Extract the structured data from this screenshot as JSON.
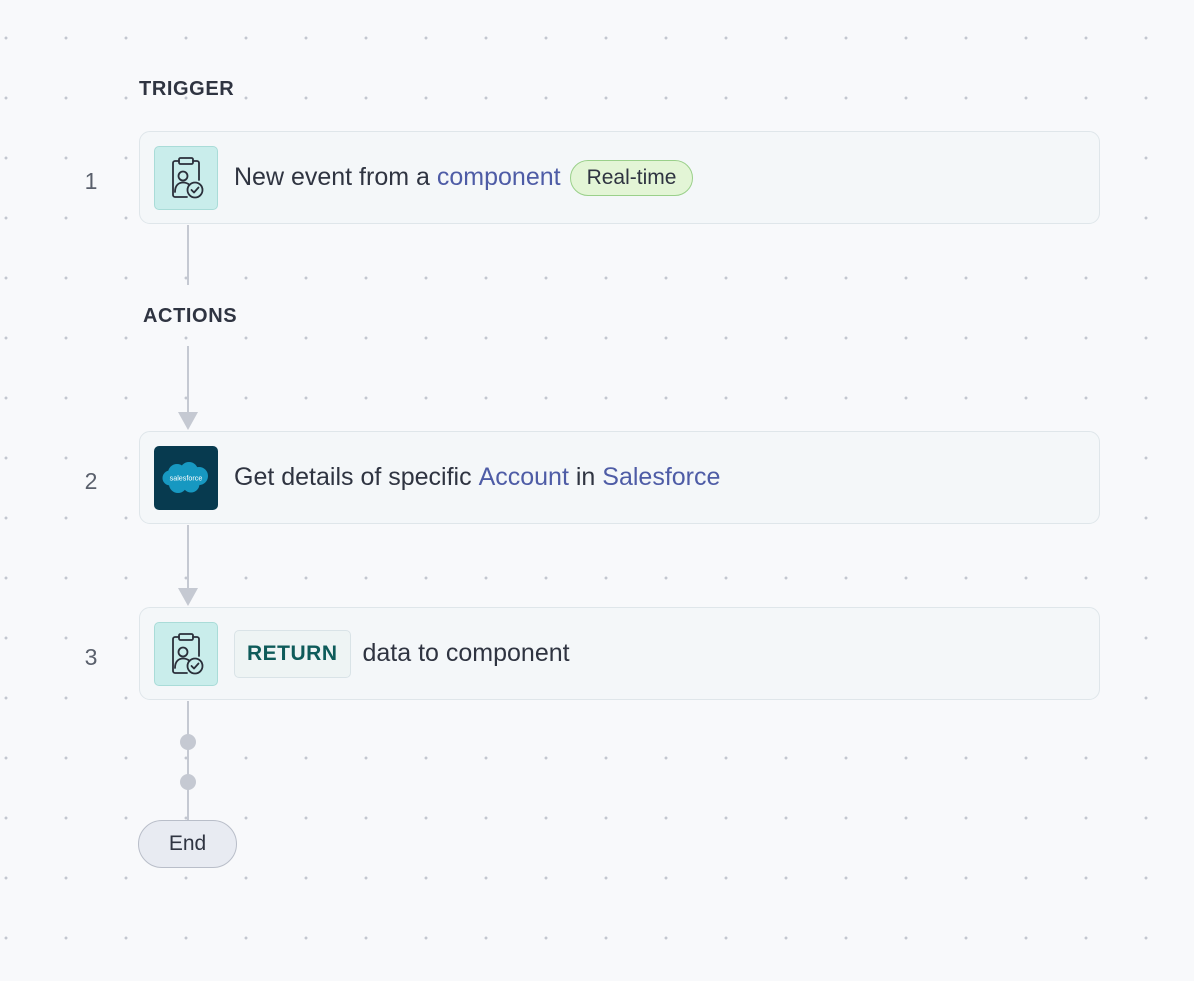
{
  "flow": {
    "trigger_label": "TRIGGER",
    "actions_label": "ACTIONS",
    "steps": [
      {
        "number": "1",
        "icon": "component-user-check-icon",
        "text_prefix": "New event from a",
        "link": "component",
        "badge": "Real-time"
      },
      {
        "number": "2",
        "icon": "salesforce-logo",
        "icon_text": "salesforce",
        "text_prefix": "Get details of specific",
        "link1": "Account",
        "middle": "in",
        "link2": "Salesforce"
      },
      {
        "number": "3",
        "icon": "component-user-check-icon",
        "tag": "RETURN",
        "text": "data to component"
      }
    ],
    "end_label": "End"
  },
  "colors": {
    "link": "#4e5ca6",
    "badge_bg": "#e3f5d6",
    "badge_border": "#9ad08a",
    "return_tag_text": "#0e5b5a",
    "salesforce_bg": "#073a4f",
    "salesforce_cloud": "#1798c1",
    "component_icon_bg": "#c9edeb"
  }
}
